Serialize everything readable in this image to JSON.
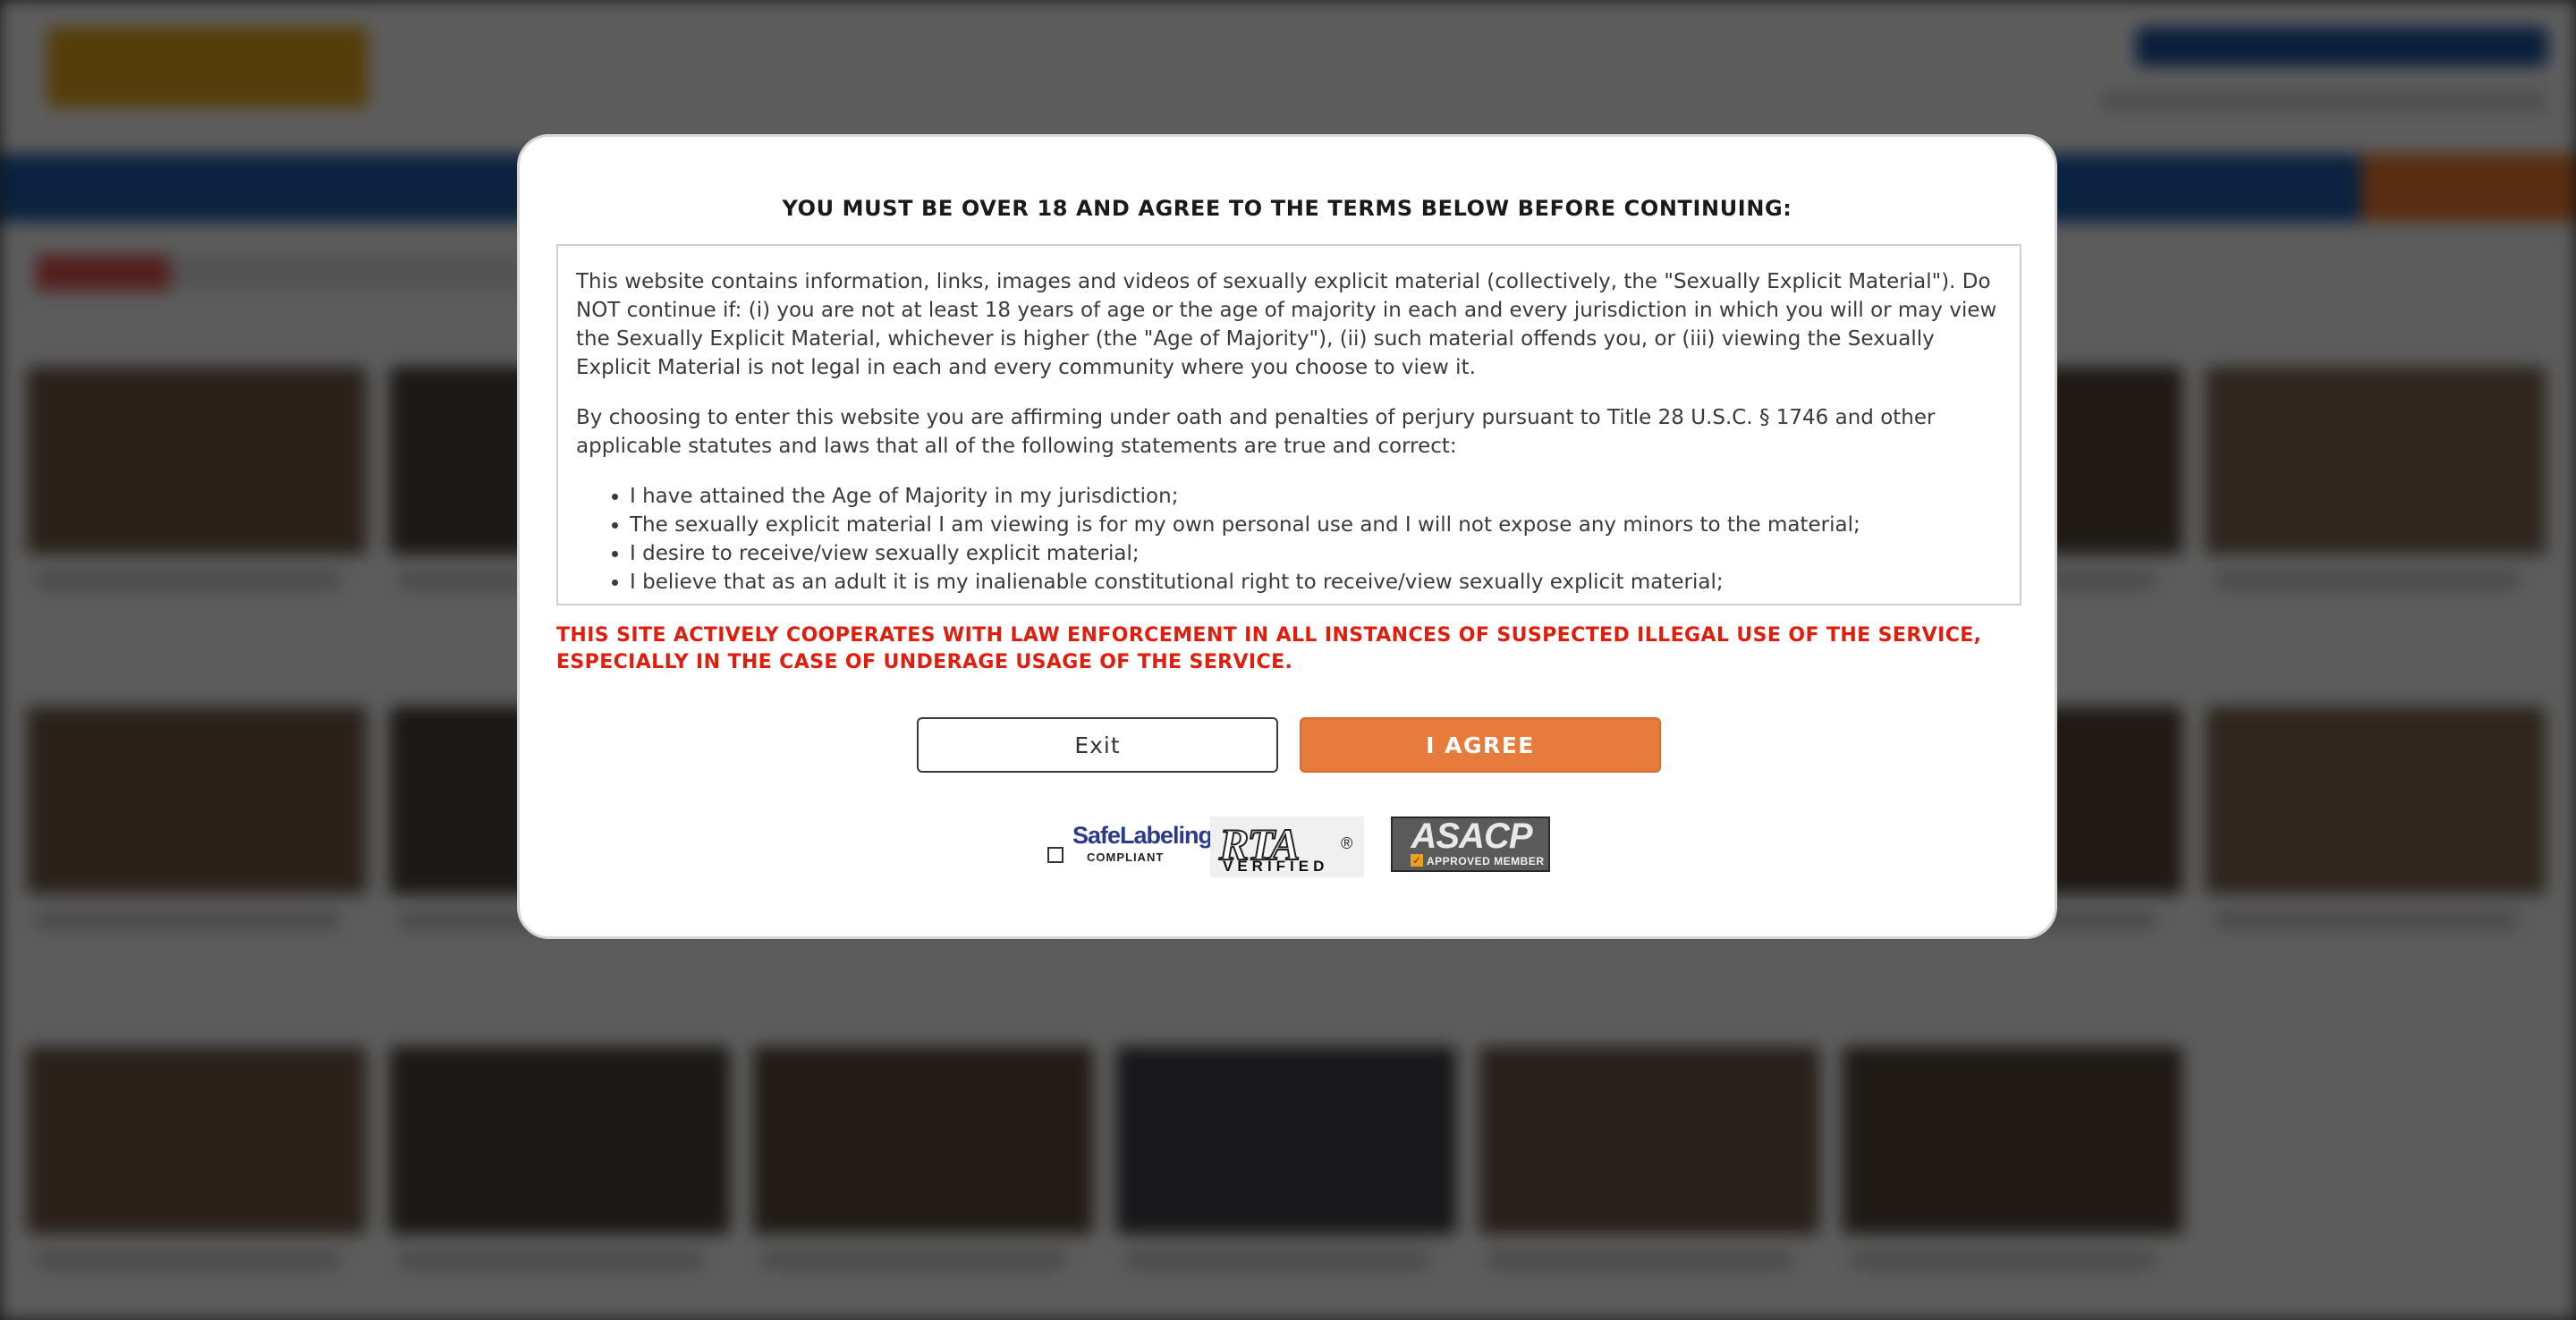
{
  "modal": {
    "title": "YOU MUST BE OVER 18 AND AGREE TO THE TERMS BELOW BEFORE CONTINUING:",
    "terms": {
      "paragraph_1": "This website contains information, links, images and videos of sexually explicit material (collectively, the \"Sexually Explicit Material\"). Do NOT continue if: (i) you are not at least 18 years of age or the age of majority in each and every jurisdiction in which you will or may view the Sexually Explicit Material, whichever is higher (the \"Age of Majority\"), (ii) such material offends you, or (iii) viewing the Sexually Explicit Material is not legal in each and every community where you choose to view it.",
      "paragraph_2": "By choosing to enter this website you are affirming under oath and penalties of perjury pursuant to Title 28 U.S.C. § 1746 and other applicable statutes and laws that all of the following statements are true and correct:",
      "statements": [
        "I have attained the Age of Majority in my jurisdiction;",
        "The sexually explicit material I am viewing is for my own personal use and I will not expose any minors to the material;",
        "I desire to receive/view sexually explicit material;",
        "I believe that as an adult it is my inalienable constitutional right to receive/view sexually explicit material;"
      ]
    },
    "warning": "THIS SITE ACTIVELY COOPERATES WITH LAW ENFORCEMENT IN ALL INSTANCES OF SUSPECTED ILLEGAL USE OF THE SERVICE, ESPECIALLY IN THE CASE OF UNDERAGE USAGE OF THE SERVICE.",
    "buttons": {
      "exit_label": "Exit",
      "agree_label": "I AGREE"
    },
    "badges": {
      "safelabeling": {
        "title": "SafeLabeling",
        "subtitle": "COMPLIANT"
      },
      "rta": {
        "title": "RTA",
        "registered": "®",
        "subtitle": "VERIFIED"
      },
      "asacp": {
        "title": "ASACP",
        "subtitle": "APPROVED MEMBER"
      }
    }
  },
  "colors": {
    "warning_red": "#e01e0e",
    "agree_orange": "#e77b3c",
    "overlay": "rgba(0,0,0,0.62)"
  }
}
